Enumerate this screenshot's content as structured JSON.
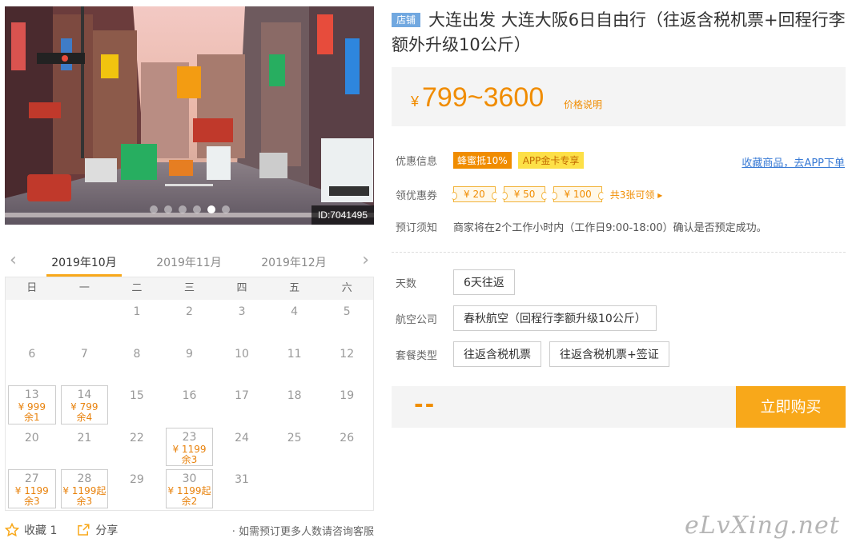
{
  "hero": {
    "id_label": "ID:7041495",
    "dot_count": 6,
    "active_dot": 4
  },
  "months": {
    "tabs": [
      "2019年10月",
      "2019年11月",
      "2019年12月"
    ],
    "active_index": 0
  },
  "calendar": {
    "weekdays": [
      "日",
      "一",
      "二",
      "三",
      "四",
      "五",
      "六"
    ],
    "leading_blanks": 2,
    "days": [
      {
        "d": "1"
      },
      {
        "d": "2"
      },
      {
        "d": "3"
      },
      {
        "d": "4"
      },
      {
        "d": "5"
      },
      {
        "d": "6"
      },
      {
        "d": "7"
      },
      {
        "d": "8"
      },
      {
        "d": "9"
      },
      {
        "d": "10"
      },
      {
        "d": "11"
      },
      {
        "d": "12"
      },
      {
        "d": "13",
        "price": "¥ 999",
        "left": "余1"
      },
      {
        "d": "14",
        "price": "¥ 799",
        "left": "余4"
      },
      {
        "d": "15"
      },
      {
        "d": "16"
      },
      {
        "d": "17"
      },
      {
        "d": "18"
      },
      {
        "d": "19"
      },
      {
        "d": "20"
      },
      {
        "d": "21"
      },
      {
        "d": "22"
      },
      {
        "d": "23",
        "price": "¥ 1199",
        "left": "余3"
      },
      {
        "d": "24"
      },
      {
        "d": "25"
      },
      {
        "d": "26"
      },
      {
        "d": "27",
        "price": "¥ 1199",
        "left": "余3"
      },
      {
        "d": "28",
        "price": "¥ 1199起",
        "left": "余3"
      },
      {
        "d": "29"
      },
      {
        "d": "30",
        "price": "¥ 1199起",
        "left": "余2"
      },
      {
        "d": "31"
      }
    ]
  },
  "actions": {
    "favorite": "收藏 1",
    "share": "分享",
    "consult": "· 如需预订更多人数请咨询客服"
  },
  "product": {
    "shop_badge": "店铺",
    "title": "大连出发 大连大阪6日自由行（往返含税机票+回程行李额外升级10公斤）"
  },
  "price": {
    "yen": "¥",
    "range": "799~3600",
    "note": "价格说明"
  },
  "promo": {
    "label": "优惠信息",
    "tag1": "蜂蜜抵10%",
    "tag2": "APP金卡专享",
    "fav_link": "收藏商品，去APP下单"
  },
  "coupons": {
    "label": "领优惠券",
    "items": [
      "¥ 20",
      "¥ 50",
      "¥ 100"
    ],
    "count": "共3张可领 ▸"
  },
  "notice": {
    "label": "预订须知",
    "text": "商家将在2个工作小时内（工作日9:00-18:00）确认是否预定成功。"
  },
  "options": {
    "days": {
      "label": "天数",
      "values": [
        "6天往返"
      ]
    },
    "airline": {
      "label": "航空公司",
      "values": [
        "春秋航空（回程行李额升级10公斤）"
      ]
    },
    "package": {
      "label": "套餐类型",
      "values": [
        "往返含税机票",
        "往返含税机票+签证"
      ]
    }
  },
  "buy": {
    "placeholder": "--",
    "button": "立即购买"
  },
  "watermark": "eLvXing.net",
  "colors": {
    "accent": "#f08c00",
    "button": "#f8a81a",
    "badge": "#71a8e0",
    "link": "#3a7bd5"
  }
}
